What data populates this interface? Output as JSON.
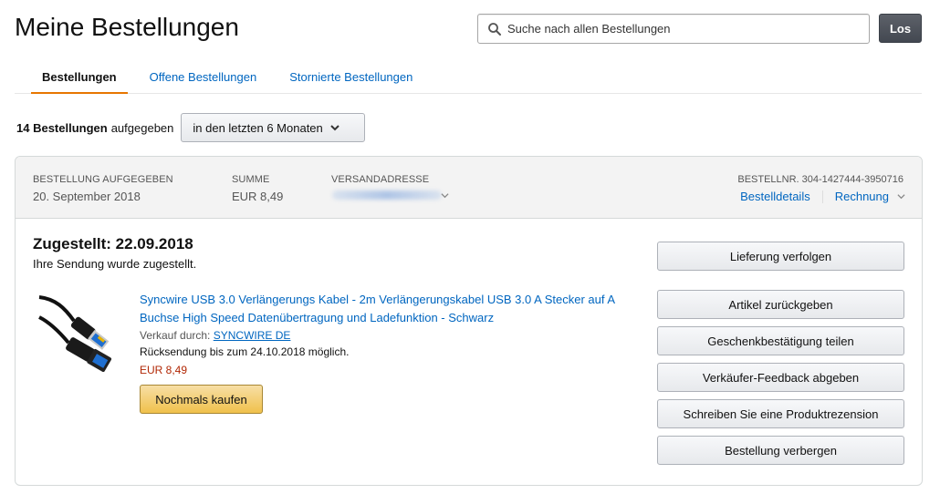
{
  "header": {
    "title": "Meine Bestellungen",
    "search_placeholder": "Suche nach allen Bestellungen",
    "search_button": "Los"
  },
  "tabs": [
    {
      "label": "Bestellungen",
      "active": true
    },
    {
      "label": "Offene Bestellungen",
      "active": false
    },
    {
      "label": "Stornierte Bestellungen",
      "active": false
    }
  ],
  "filter": {
    "count_label": "14 Bestellungen",
    "suffix": "aufgegeben",
    "range_selected": "in den letzten 6 Monaten"
  },
  "order": {
    "placed_label": "BESTELLUNG AUFGEGEBEN",
    "placed_value": "20. September 2018",
    "total_label": "SUMME",
    "total_value": "EUR 8,49",
    "ship_label": "VERSANDADRESSE",
    "order_number": "BESTELLNR. 304-1427444-3950716",
    "details_link": "Bestelldetails",
    "invoice_link": "Rechnung",
    "status_title": "Zugestellt: 22.09.2018",
    "status_sub": "Ihre Sendung wurde zugestellt.",
    "item": {
      "title": "Syncwire USB 3.0 Verlängerungs Kabel - 2m Verlängerungskabel USB 3.0 A Stecker auf A Buchse High Speed Datenübertragung und Ladefunktion - Schwarz",
      "seller_prefix": "Verkauf durch:",
      "seller_name": "SYNCWIRE DE",
      "return_note": "Rücksendung bis zum 24.10.2018 möglich.",
      "price": "EUR 8,49",
      "buy_again": "Nochmals kaufen"
    },
    "actions": [
      "Lieferung verfolgen",
      "Artikel zurückgeben",
      "Geschenkbestätigung teilen",
      "Verkäufer-Feedback abgeben",
      "Schreiben Sie eine Produktrezension",
      "Bestellung verbergen"
    ]
  },
  "colors": {
    "link": "#0066c0",
    "price": "#b12704",
    "tab_active_underline": "#e77600",
    "buy_button": "#f0c14b"
  }
}
